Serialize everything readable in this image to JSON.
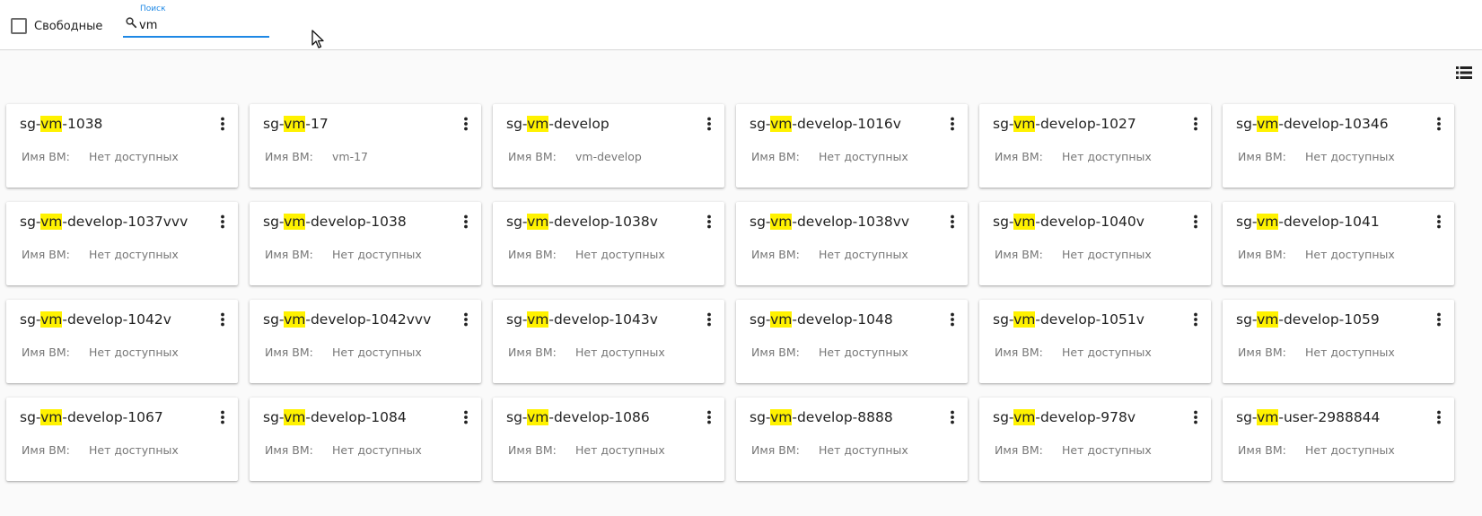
{
  "filter": {
    "checkbox_label": "Свободные",
    "checked": false
  },
  "search": {
    "floating_label": "Поиск",
    "value": "vm",
    "icon": "search-icon"
  },
  "toolbar": {
    "view_toggle_icon": "list-view-icon"
  },
  "colors": {
    "accent": "#1e88e5",
    "highlight": "#fff200"
  },
  "cards": [
    {
      "prefix": "sg-",
      "match": "vm",
      "suffix": "-1038",
      "field_label": "Имя ВМ:",
      "field_value": "Нет доступных"
    },
    {
      "prefix": "sg-",
      "match": "vm",
      "suffix": "-17",
      "field_label": "Имя ВМ:",
      "field_value": "vm-17"
    },
    {
      "prefix": "sg-",
      "match": "vm",
      "suffix": "-develop",
      "field_label": "Имя ВМ:",
      "field_value": "vm-develop"
    },
    {
      "prefix": "sg-",
      "match": "vm",
      "suffix": "-develop-1016v",
      "field_label": "Имя ВМ:",
      "field_value": "Нет доступных"
    },
    {
      "prefix": "sg-",
      "match": "vm",
      "suffix": "-develop-1027",
      "field_label": "Имя ВМ:",
      "field_value": "Нет доступных"
    },
    {
      "prefix": "sg-",
      "match": "vm",
      "suffix": "-develop-10346",
      "field_label": "Имя ВМ:",
      "field_value": "Нет доступных"
    },
    {
      "prefix": "sg-",
      "match": "vm",
      "suffix": "-develop-1037vvv",
      "field_label": "Имя ВМ:",
      "field_value": "Нет доступных"
    },
    {
      "prefix": "sg-",
      "match": "vm",
      "suffix": "-develop-1038",
      "field_label": "Имя ВМ:",
      "field_value": "Нет доступных"
    },
    {
      "prefix": "sg-",
      "match": "vm",
      "suffix": "-develop-1038v",
      "field_label": "Имя ВМ:",
      "field_value": "Нет доступных"
    },
    {
      "prefix": "sg-",
      "match": "vm",
      "suffix": "-develop-1038vv",
      "field_label": "Имя ВМ:",
      "field_value": "Нет доступных"
    },
    {
      "prefix": "sg-",
      "match": "vm",
      "suffix": "-develop-1040v",
      "field_label": "Имя ВМ:",
      "field_value": "Нет доступных"
    },
    {
      "prefix": "sg-",
      "match": "vm",
      "suffix": "-develop-1041",
      "field_label": "Имя ВМ:",
      "field_value": "Нет доступных"
    },
    {
      "prefix": "sg-",
      "match": "vm",
      "suffix": "-develop-1042v",
      "field_label": "Имя ВМ:",
      "field_value": "Нет доступных"
    },
    {
      "prefix": "sg-",
      "match": "vm",
      "suffix": "-develop-1042vvv",
      "field_label": "Имя ВМ:",
      "field_value": "Нет доступных"
    },
    {
      "prefix": "sg-",
      "match": "vm",
      "suffix": "-develop-1043v",
      "field_label": "Имя ВМ:",
      "field_value": "Нет доступных"
    },
    {
      "prefix": "sg-",
      "match": "vm",
      "suffix": "-develop-1048",
      "field_label": "Имя ВМ:",
      "field_value": "Нет доступных"
    },
    {
      "prefix": "sg-",
      "match": "vm",
      "suffix": "-develop-1051v",
      "field_label": "Имя ВМ:",
      "field_value": "Нет доступных"
    },
    {
      "prefix": "sg-",
      "match": "vm",
      "suffix": "-develop-1059",
      "field_label": "Имя ВМ:",
      "field_value": "Нет доступных"
    },
    {
      "prefix": "sg-",
      "match": "vm",
      "suffix": "-develop-1067",
      "field_label": "Имя ВМ:",
      "field_value": "Нет доступных"
    },
    {
      "prefix": "sg-",
      "match": "vm",
      "suffix": "-develop-1084",
      "field_label": "Имя ВМ:",
      "field_value": "Нет доступных"
    },
    {
      "prefix": "sg-",
      "match": "vm",
      "suffix": "-develop-1086",
      "field_label": "Имя ВМ:",
      "field_value": "Нет доступных"
    },
    {
      "prefix": "sg-",
      "match": "vm",
      "suffix": "-develop-8888",
      "field_label": "Имя ВМ:",
      "field_value": "Нет доступных"
    },
    {
      "prefix": "sg-",
      "match": "vm",
      "suffix": "-develop-978v",
      "field_label": "Имя ВМ:",
      "field_value": "Нет доступных"
    },
    {
      "prefix": "sg-",
      "match": "vm",
      "suffix": "-user-2988844",
      "field_label": "Имя ВМ:",
      "field_value": "Нет доступных"
    }
  ]
}
